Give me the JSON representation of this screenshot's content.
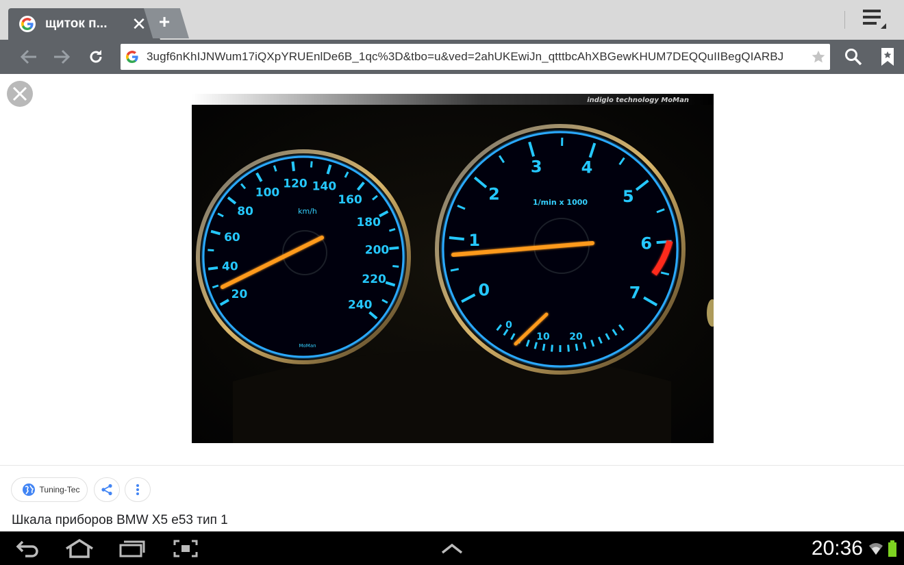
{
  "tab": {
    "title": "щиток п...",
    "close_glyph": "✕",
    "new_tab_glyph": "+"
  },
  "toolbar": {
    "url": "3ugf6nKhIJNWum17iQXpYRUEnlDe6B_1qc%3D&tbo=u&ved=2ahUKEwiJn_qtttbcAhXBGewKHUM7DEQQuIIBegQIARBJ",
    "icons": [
      "back-arrow-icon",
      "forward-arrow-icon",
      "reload-icon",
      "google-logo-icon",
      "star-icon",
      "search-icon",
      "bookmark-icon",
      "menu-icon"
    ]
  },
  "image": {
    "watermark": "indiglo technology MoMan",
    "speedo_unit": "km/h",
    "speedo_ticks": [
      "20",
      "40",
      "60",
      "80",
      "100",
      "120",
      "140",
      "160",
      "180",
      "200",
      "220",
      "240"
    ],
    "speedo_brand": "MoMan",
    "tacho_unit": "1/min x 1000",
    "tacho_ticks": [
      "0",
      "1",
      "2",
      "3",
      "4",
      "5",
      "6",
      "7"
    ],
    "econ_ticks": [
      "0",
      "10",
      "20"
    ]
  },
  "result": {
    "source": "Tuning-Tec",
    "caption": "Шкала приборов BMW X5 e53 тип 1"
  },
  "status": {
    "time": "20:36"
  },
  "colors": {
    "chrome_dark": "#5f6368",
    "tabstrip": "#d9d9d9",
    "gauge_glow": "#25c8ff",
    "needle": "#ff9a1a",
    "redline": "#ff2a1a"
  }
}
